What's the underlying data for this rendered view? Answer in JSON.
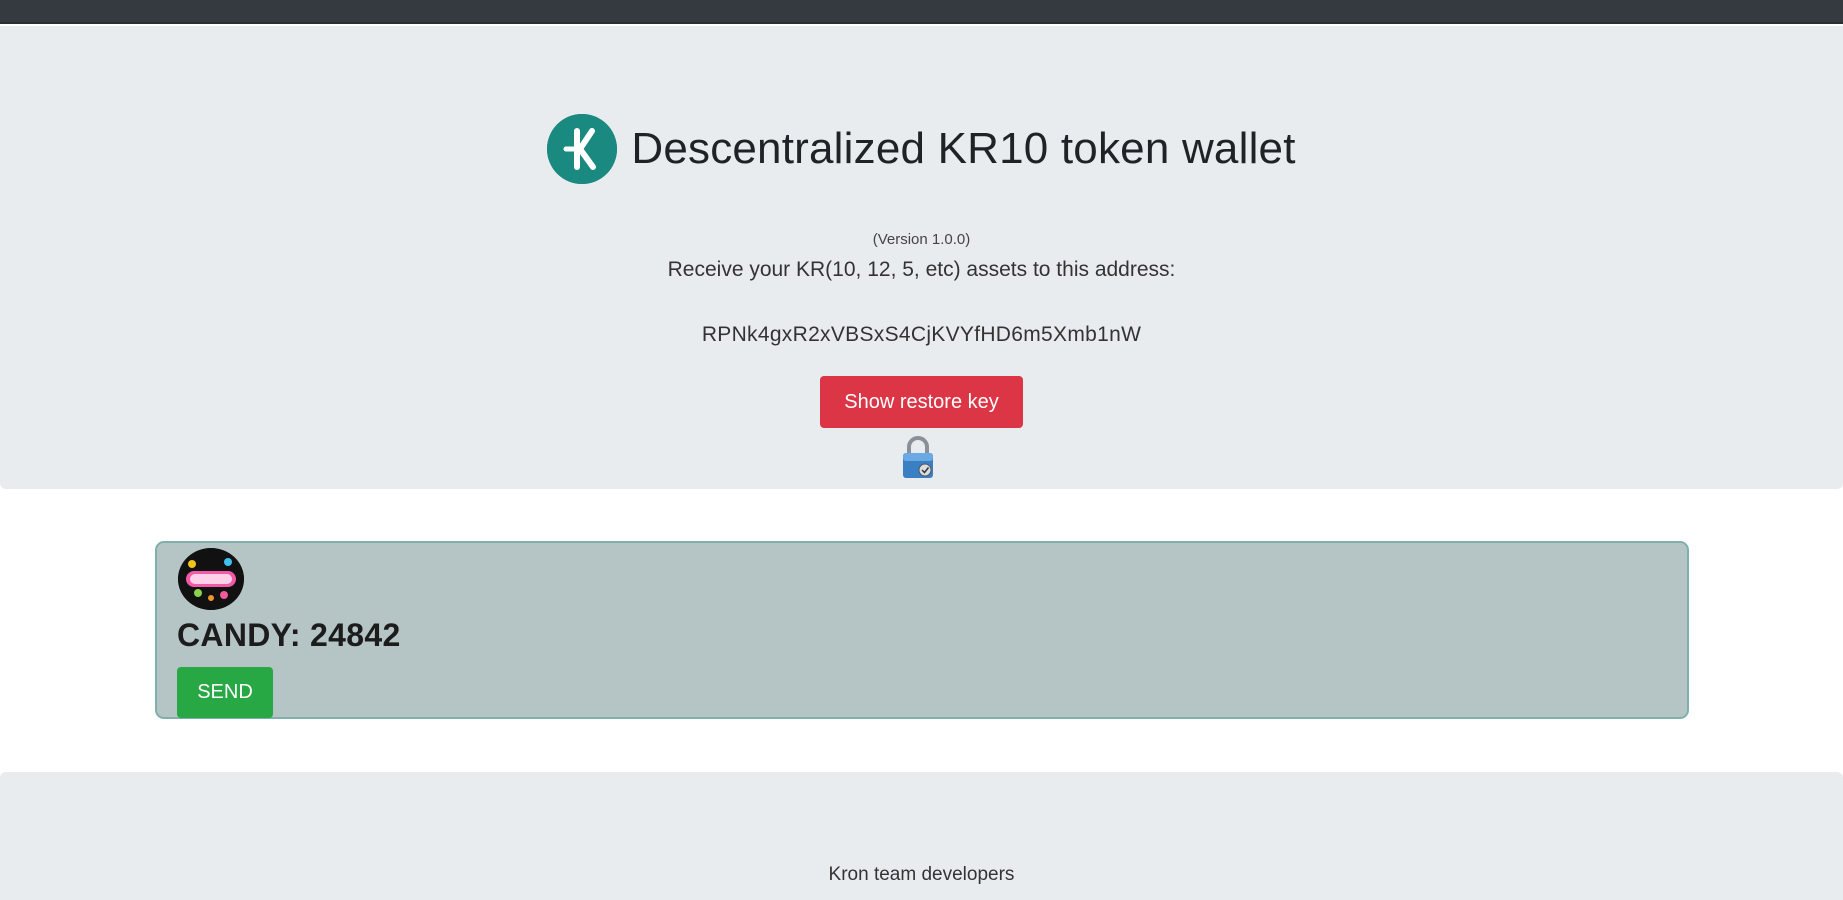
{
  "header": {
    "title": "Descentralized KR10 token wallet",
    "version": "(Version 1.0.0)",
    "receive_text": "Receive your KR(10, 12, 5, etc) assets to this address:",
    "address": "RPNk4gxR2xVBSxS4CjKVYfHD6m5Xmb1nW",
    "restore_button_label": "Show restore key",
    "logo_icon": "kron-logo-icon",
    "lock_icon": "lock-icon"
  },
  "token": {
    "name": "CANDY",
    "balance_text": "CANDY: 24842",
    "balance": 24842,
    "send_label": "SEND",
    "avatar_icon": "candy-token-icon"
  },
  "footer": {
    "text": "Kron team developers"
  },
  "colors": {
    "accent_teal": "#1a8a80",
    "danger_red": "#dc3545",
    "success_green": "#28a745",
    "card_bg": "#b5c5c5",
    "jumbotron_bg": "#e9ecef",
    "navbar_bg": "#343a40"
  }
}
